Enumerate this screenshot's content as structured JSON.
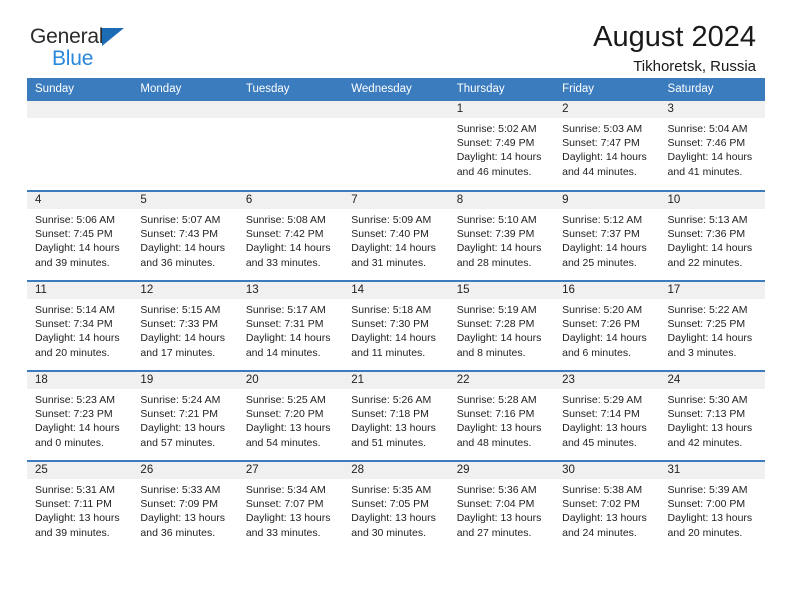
{
  "logo": {
    "name": "General Blue",
    "word_one": "General",
    "word_two": "Blue",
    "triangle_color": "#1b6cb5",
    "blue_text_color": "#2a88da"
  },
  "header": {
    "title": "August 2024",
    "subtitle": "Tikhoretsk, Russia"
  },
  "theme": {
    "header_band": "#3a7cbe",
    "day_number_band": "#f0f0f0",
    "cell_background": "#ffffff",
    "text": "#222222"
  },
  "weekday_headers": [
    "Sunday",
    "Monday",
    "Tuesday",
    "Wednesday",
    "Thursday",
    "Friday",
    "Saturday"
  ],
  "weeks": [
    [
      {
        "day": "",
        "empty": true,
        "sunrise": "",
        "sunset": "",
        "daylight_line1": "",
        "daylight_line2": ""
      },
      {
        "day": "",
        "empty": true,
        "sunrise": "",
        "sunset": "",
        "daylight_line1": "",
        "daylight_line2": ""
      },
      {
        "day": "",
        "empty": true,
        "sunrise": "",
        "sunset": "",
        "daylight_line1": "",
        "daylight_line2": ""
      },
      {
        "day": "",
        "empty": true,
        "sunrise": "",
        "sunset": "",
        "daylight_line1": "",
        "daylight_line2": ""
      },
      {
        "day": "1",
        "empty": false,
        "sunrise": "Sunrise: 5:02 AM",
        "sunset": "Sunset: 7:49 PM",
        "daylight_line1": "Daylight: 14 hours",
        "daylight_line2": "and 46 minutes."
      },
      {
        "day": "2",
        "empty": false,
        "sunrise": "Sunrise: 5:03 AM",
        "sunset": "Sunset: 7:47 PM",
        "daylight_line1": "Daylight: 14 hours",
        "daylight_line2": "and 44 minutes."
      },
      {
        "day": "3",
        "empty": false,
        "sunrise": "Sunrise: 5:04 AM",
        "sunset": "Sunset: 7:46 PM",
        "daylight_line1": "Daylight: 14 hours",
        "daylight_line2": "and 41 minutes."
      }
    ],
    [
      {
        "day": "4",
        "empty": false,
        "sunrise": "Sunrise: 5:06 AM",
        "sunset": "Sunset: 7:45 PM",
        "daylight_line1": "Daylight: 14 hours",
        "daylight_line2": "and 39 minutes."
      },
      {
        "day": "5",
        "empty": false,
        "sunrise": "Sunrise: 5:07 AM",
        "sunset": "Sunset: 7:43 PM",
        "daylight_line1": "Daylight: 14 hours",
        "daylight_line2": "and 36 minutes."
      },
      {
        "day": "6",
        "empty": false,
        "sunrise": "Sunrise: 5:08 AM",
        "sunset": "Sunset: 7:42 PM",
        "daylight_line1": "Daylight: 14 hours",
        "daylight_line2": "and 33 minutes."
      },
      {
        "day": "7",
        "empty": false,
        "sunrise": "Sunrise: 5:09 AM",
        "sunset": "Sunset: 7:40 PM",
        "daylight_line1": "Daylight: 14 hours",
        "daylight_line2": "and 31 minutes."
      },
      {
        "day": "8",
        "empty": false,
        "sunrise": "Sunrise: 5:10 AM",
        "sunset": "Sunset: 7:39 PM",
        "daylight_line1": "Daylight: 14 hours",
        "daylight_line2": "and 28 minutes."
      },
      {
        "day": "9",
        "empty": false,
        "sunrise": "Sunrise: 5:12 AM",
        "sunset": "Sunset: 7:37 PM",
        "daylight_line1": "Daylight: 14 hours",
        "daylight_line2": "and 25 minutes."
      },
      {
        "day": "10",
        "empty": false,
        "sunrise": "Sunrise: 5:13 AM",
        "sunset": "Sunset: 7:36 PM",
        "daylight_line1": "Daylight: 14 hours",
        "daylight_line2": "and 22 minutes."
      }
    ],
    [
      {
        "day": "11",
        "empty": false,
        "sunrise": "Sunrise: 5:14 AM",
        "sunset": "Sunset: 7:34 PM",
        "daylight_line1": "Daylight: 14 hours",
        "daylight_line2": "and 20 minutes."
      },
      {
        "day": "12",
        "empty": false,
        "sunrise": "Sunrise: 5:15 AM",
        "sunset": "Sunset: 7:33 PM",
        "daylight_line1": "Daylight: 14 hours",
        "daylight_line2": "and 17 minutes."
      },
      {
        "day": "13",
        "empty": false,
        "sunrise": "Sunrise: 5:17 AM",
        "sunset": "Sunset: 7:31 PM",
        "daylight_line1": "Daylight: 14 hours",
        "daylight_line2": "and 14 minutes."
      },
      {
        "day": "14",
        "empty": false,
        "sunrise": "Sunrise: 5:18 AM",
        "sunset": "Sunset: 7:30 PM",
        "daylight_line1": "Daylight: 14 hours",
        "daylight_line2": "and 11 minutes."
      },
      {
        "day": "15",
        "empty": false,
        "sunrise": "Sunrise: 5:19 AM",
        "sunset": "Sunset: 7:28 PM",
        "daylight_line1": "Daylight: 14 hours",
        "daylight_line2": "and 8 minutes."
      },
      {
        "day": "16",
        "empty": false,
        "sunrise": "Sunrise: 5:20 AM",
        "sunset": "Sunset: 7:26 PM",
        "daylight_line1": "Daylight: 14 hours",
        "daylight_line2": "and 6 minutes."
      },
      {
        "day": "17",
        "empty": false,
        "sunrise": "Sunrise: 5:22 AM",
        "sunset": "Sunset: 7:25 PM",
        "daylight_line1": "Daylight: 14 hours",
        "daylight_line2": "and 3 minutes."
      }
    ],
    [
      {
        "day": "18",
        "empty": false,
        "sunrise": "Sunrise: 5:23 AM",
        "sunset": "Sunset: 7:23 PM",
        "daylight_line1": "Daylight: 14 hours",
        "daylight_line2": "and 0 minutes."
      },
      {
        "day": "19",
        "empty": false,
        "sunrise": "Sunrise: 5:24 AM",
        "sunset": "Sunset: 7:21 PM",
        "daylight_line1": "Daylight: 13 hours",
        "daylight_line2": "and 57 minutes."
      },
      {
        "day": "20",
        "empty": false,
        "sunrise": "Sunrise: 5:25 AM",
        "sunset": "Sunset: 7:20 PM",
        "daylight_line1": "Daylight: 13 hours",
        "daylight_line2": "and 54 minutes."
      },
      {
        "day": "21",
        "empty": false,
        "sunrise": "Sunrise: 5:26 AM",
        "sunset": "Sunset: 7:18 PM",
        "daylight_line1": "Daylight: 13 hours",
        "daylight_line2": "and 51 minutes."
      },
      {
        "day": "22",
        "empty": false,
        "sunrise": "Sunrise: 5:28 AM",
        "sunset": "Sunset: 7:16 PM",
        "daylight_line1": "Daylight: 13 hours",
        "daylight_line2": "and 48 minutes."
      },
      {
        "day": "23",
        "empty": false,
        "sunrise": "Sunrise: 5:29 AM",
        "sunset": "Sunset: 7:14 PM",
        "daylight_line1": "Daylight: 13 hours",
        "daylight_line2": "and 45 minutes."
      },
      {
        "day": "24",
        "empty": false,
        "sunrise": "Sunrise: 5:30 AM",
        "sunset": "Sunset: 7:13 PM",
        "daylight_line1": "Daylight: 13 hours",
        "daylight_line2": "and 42 minutes."
      }
    ],
    [
      {
        "day": "25",
        "empty": false,
        "sunrise": "Sunrise: 5:31 AM",
        "sunset": "Sunset: 7:11 PM",
        "daylight_line1": "Daylight: 13 hours",
        "daylight_line2": "and 39 minutes."
      },
      {
        "day": "26",
        "empty": false,
        "sunrise": "Sunrise: 5:33 AM",
        "sunset": "Sunset: 7:09 PM",
        "daylight_line1": "Daylight: 13 hours",
        "daylight_line2": "and 36 minutes."
      },
      {
        "day": "27",
        "empty": false,
        "sunrise": "Sunrise: 5:34 AM",
        "sunset": "Sunset: 7:07 PM",
        "daylight_line1": "Daylight: 13 hours",
        "daylight_line2": "and 33 minutes."
      },
      {
        "day": "28",
        "empty": false,
        "sunrise": "Sunrise: 5:35 AM",
        "sunset": "Sunset: 7:05 PM",
        "daylight_line1": "Daylight: 13 hours",
        "daylight_line2": "and 30 minutes."
      },
      {
        "day": "29",
        "empty": false,
        "sunrise": "Sunrise: 5:36 AM",
        "sunset": "Sunset: 7:04 PM",
        "daylight_line1": "Daylight: 13 hours",
        "daylight_line2": "and 27 minutes."
      },
      {
        "day": "30",
        "empty": false,
        "sunrise": "Sunrise: 5:38 AM",
        "sunset": "Sunset: 7:02 PM",
        "daylight_line1": "Daylight: 13 hours",
        "daylight_line2": "and 24 minutes."
      },
      {
        "day": "31",
        "empty": false,
        "sunrise": "Sunrise: 5:39 AM",
        "sunset": "Sunset: 7:00 PM",
        "daylight_line1": "Daylight: 13 hours",
        "daylight_line2": "and 20 minutes."
      }
    ]
  ]
}
